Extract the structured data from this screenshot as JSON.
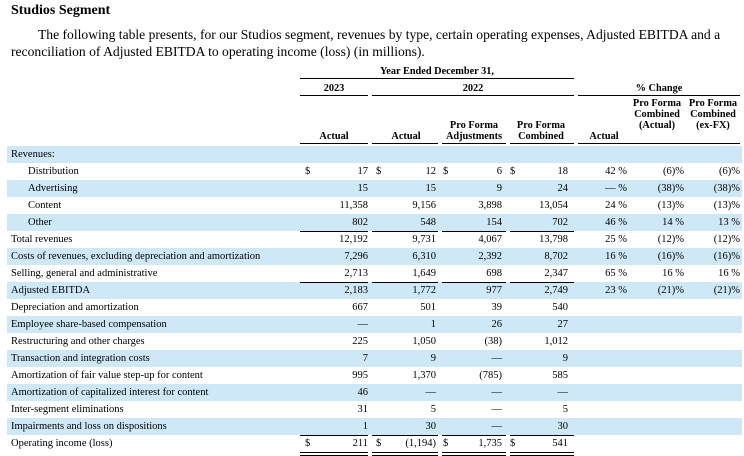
{
  "title": "Studios Segment",
  "intro": "The following table presents, for our Studios segment, revenues by type, certain operating expenses, Adjusted EBITDA and a reconciliation of Adjusted EBITDA to operating income (loss) (in millions).",
  "headers": {
    "period": "Year Ended December 31,",
    "year_2023": "2023",
    "year_2022": "2022",
    "pct_change": "% Change",
    "col_actual_2023": "Actual",
    "col_actual_2022": "Actual",
    "col_proforma_adj": "Pro Forma Adjustments",
    "col_proforma_comb": "Pro Forma Combined",
    "col_pct_actual": "Actual",
    "col_pct_pf_actual": "Pro Forma Combined (Actual)",
    "col_pct_pf_exfx": "Pro Forma Combined (ex-FX)"
  },
  "rows": [
    {
      "label": "Revenues:",
      "indent": false,
      "shade": true,
      "a23": "",
      "a22": "",
      "adj": "",
      "comb": "",
      "p1": "",
      "p2": "",
      "p3": "",
      "dollar": false
    },
    {
      "label": "Distribution",
      "indent": true,
      "shade": false,
      "a23": "17",
      "a22": "12",
      "adj": "6",
      "comb": "18",
      "p1": "42 %",
      "p2": "(6)%",
      "p3": "(6)%",
      "dollar": true
    },
    {
      "label": "Advertising",
      "indent": true,
      "shade": true,
      "a23": "15",
      "a22": "15",
      "adj": "9",
      "comb": "24",
      "p1": "— %",
      "p2": "(38)%",
      "p3": "(38)%",
      "dollar": false
    },
    {
      "label": "Content",
      "indent": true,
      "shade": false,
      "a23": "11,358",
      "a22": "9,156",
      "adj": "3,898",
      "comb": "13,054",
      "p1": "24 %",
      "p2": "(13)%",
      "p3": "(13)%",
      "dollar": false
    },
    {
      "label": "Other",
      "indent": true,
      "shade": true,
      "a23": "802",
      "a22": "548",
      "adj": "154",
      "comb": "702",
      "p1": "46 %",
      "p2": "14 %",
      "p3": "13 %",
      "dollar": false
    },
    {
      "label": "Total revenues",
      "indent": false,
      "shade": false,
      "a23": "12,192",
      "a22": "9,731",
      "adj": "4,067",
      "comb": "13,798",
      "p1": "25 %",
      "p2": "(12)%",
      "p3": "(12)%",
      "dollar": false
    },
    {
      "label": "Costs of revenues, excluding depreciation and amortization",
      "indent": false,
      "shade": true,
      "a23": "7,296",
      "a22": "6,310",
      "adj": "2,392",
      "comb": "8,702",
      "p1": "16 %",
      "p2": "(16)%",
      "p3": "(16)%",
      "dollar": false
    },
    {
      "label": "Selling, general and administrative",
      "indent": false,
      "shade": false,
      "a23": "2,713",
      "a22": "1,649",
      "adj": "698",
      "comb": "2,347",
      "p1": "65 %",
      "p2": "16 %",
      "p3": "16 %",
      "dollar": false
    },
    {
      "label": "Adjusted EBITDA",
      "indent": false,
      "shade": true,
      "a23": "2,183",
      "a22": "1,772",
      "adj": "977",
      "comb": "2,749",
      "p1": "23 %",
      "p2": "(21)%",
      "p3": "(21)%",
      "dollar": false
    },
    {
      "label": "Depreciation and amortization",
      "indent": false,
      "shade": false,
      "a23": "667",
      "a22": "501",
      "adj": "39",
      "comb": "540",
      "p1": "",
      "p2": "",
      "p3": "",
      "dollar": false
    },
    {
      "label": "Employee share-based compensation",
      "indent": false,
      "shade": true,
      "a23": "—",
      "a22": "1",
      "adj": "26",
      "comb": "27",
      "p1": "",
      "p2": "",
      "p3": "",
      "dollar": false
    },
    {
      "label": "Restructuring and other charges",
      "indent": false,
      "shade": false,
      "a23": "225",
      "a22": "1,050",
      "adj": "(38)",
      "comb": "1,012",
      "p1": "",
      "p2": "",
      "p3": "",
      "dollar": false
    },
    {
      "label": "Transaction and integration costs",
      "indent": false,
      "shade": true,
      "a23": "7",
      "a22": "9",
      "adj": "—",
      "comb": "9",
      "p1": "",
      "p2": "",
      "p3": "",
      "dollar": false
    },
    {
      "label": "Amortization of fair value step-up for content",
      "indent": false,
      "shade": false,
      "a23": "995",
      "a22": "1,370",
      "adj": "(785)",
      "comb": "585",
      "p1": "",
      "p2": "",
      "p3": "",
      "dollar": false
    },
    {
      "label": "Amortization of capitalized interest for content",
      "indent": false,
      "shade": true,
      "a23": "46",
      "a22": "—",
      "adj": "—",
      "comb": "—",
      "p1": "",
      "p2": "",
      "p3": "",
      "dollar": false
    },
    {
      "label": "Inter-segment eliminations",
      "indent": false,
      "shade": false,
      "a23": "31",
      "a22": "5",
      "adj": "—",
      "comb": "5",
      "p1": "",
      "p2": "",
      "p3": "",
      "dollar": false
    },
    {
      "label": "Impairments and loss on dispositions",
      "indent": false,
      "shade": true,
      "a23": "1",
      "a22": "30",
      "adj": "—",
      "comb": "30",
      "p1": "",
      "p2": "",
      "p3": "",
      "dollar": false
    },
    {
      "label": "Operating income (loss)",
      "indent": false,
      "shade": false,
      "a23": "211",
      "a22": "(1,194)",
      "adj": "1,735",
      "comb": "541",
      "p1": "",
      "p2": "",
      "p3": "",
      "dollar": true
    }
  ],
  "currency_symbol": "$"
}
